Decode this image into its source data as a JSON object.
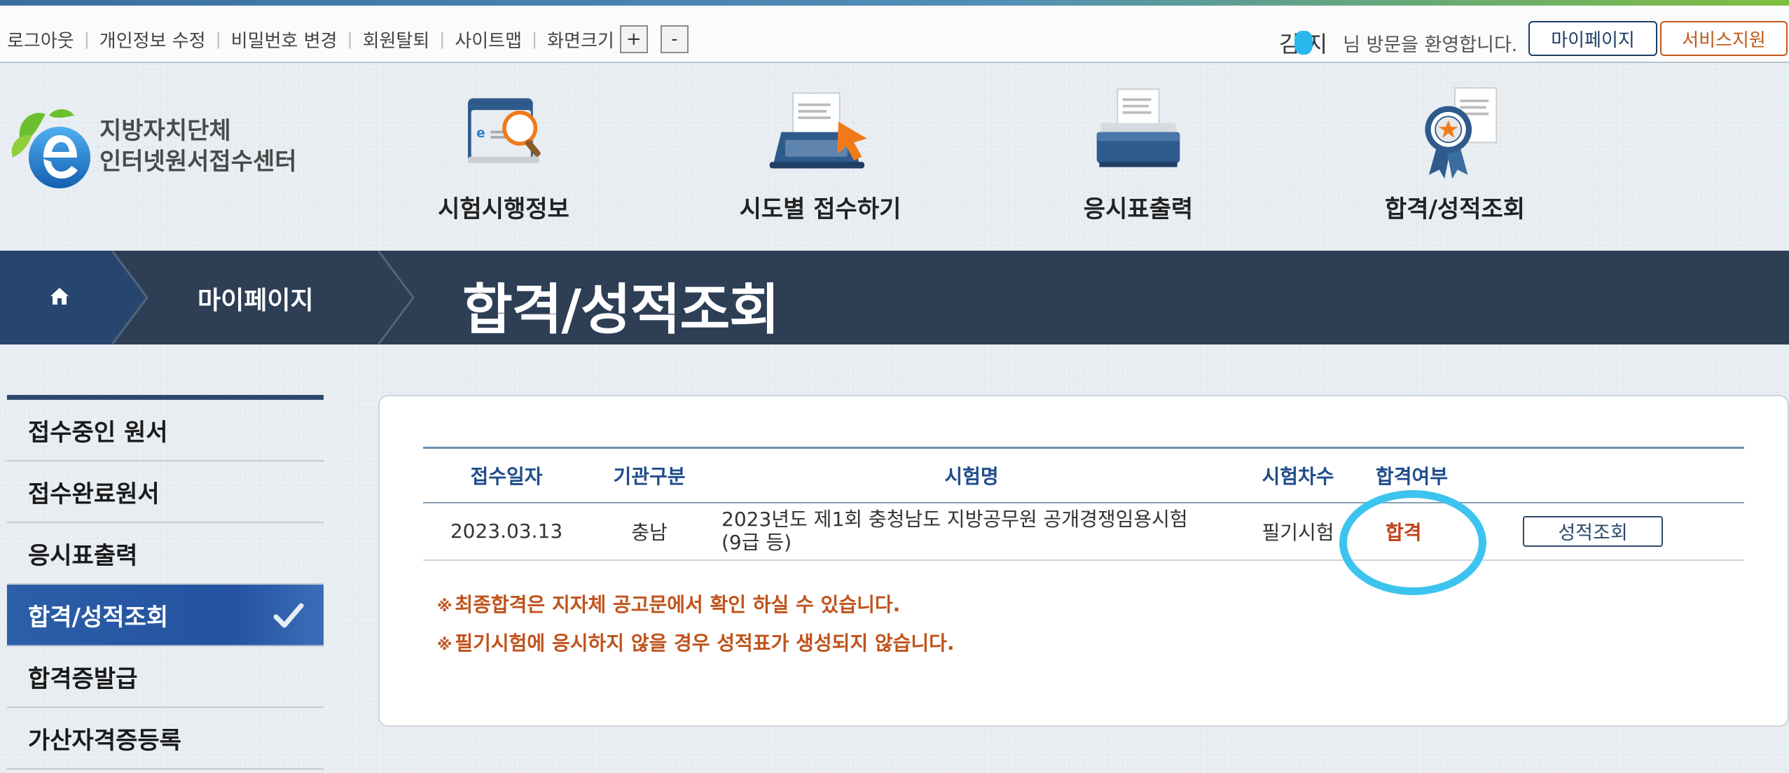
{
  "colors": {
    "brand_dark": "#2d3e55",
    "brand_blue": "#27466f",
    "accent_orange": "#c05a1a",
    "result_red": "#c0431a",
    "header_blue": "#1f4d8c",
    "annotation": "#3cc4ee"
  },
  "util": {
    "links": [
      "로그아웃",
      "개인정보 수정",
      "비밀번호 변경",
      "회원탈퇴",
      "사이트맵",
      "화면크기"
    ],
    "zoom_in": "+",
    "zoom_out": "-",
    "user_name_visible": "김  지",
    "welcome_text": "님 방문을 환영합니다.",
    "mypage_button": "마이페이지",
    "service_button": "서비스지원"
  },
  "logo": {
    "line1": "지방자치단체",
    "line2": "인터넷원서접수센터",
    "icon": "e-leaf-logo"
  },
  "nav": [
    {
      "label": "시험시행정보",
      "icon": "folder-magnifier-icon"
    },
    {
      "label": "시도별 접수하기",
      "icon": "laptop-cursor-icon"
    },
    {
      "label": "응시표출력",
      "icon": "printer-icon"
    },
    {
      "label": "합격/성적조회",
      "icon": "award-ribbon-icon"
    }
  ],
  "breadcrumb": {
    "home_icon": "home-icon",
    "section": "마이페이지",
    "title": "합격/성적조회"
  },
  "sidebar": {
    "items": [
      {
        "label": "접수중인 원서",
        "active": false
      },
      {
        "label": "접수완료원서",
        "active": false
      },
      {
        "label": "응시표출력",
        "active": false
      },
      {
        "label": "합격/성적조회",
        "active": true
      },
      {
        "label": "합격증발급",
        "active": false
      },
      {
        "label": "가산자격증등록",
        "active": false
      }
    ]
  },
  "table": {
    "headers": [
      "접수일자",
      "기관구분",
      "시험명",
      "시험차수",
      "합격여부"
    ],
    "rows": [
      {
        "date": "2023.03.13",
        "org": "충남",
        "exam_line1": "2023년도 제1회 충청남도 지방공무원 공개경쟁임용시험",
        "exam_line2": "(9급 등)",
        "round": "필기시험",
        "result": "합격",
        "action": "성적조회"
      }
    ]
  },
  "notices": [
    "최종합격은 지자체 공고문에서 확인 하실 수 있습니다.",
    "필기시험에 응시하지 않을 경우 성적표가 생성되지 않습니다."
  ],
  "notice_mark": "※"
}
